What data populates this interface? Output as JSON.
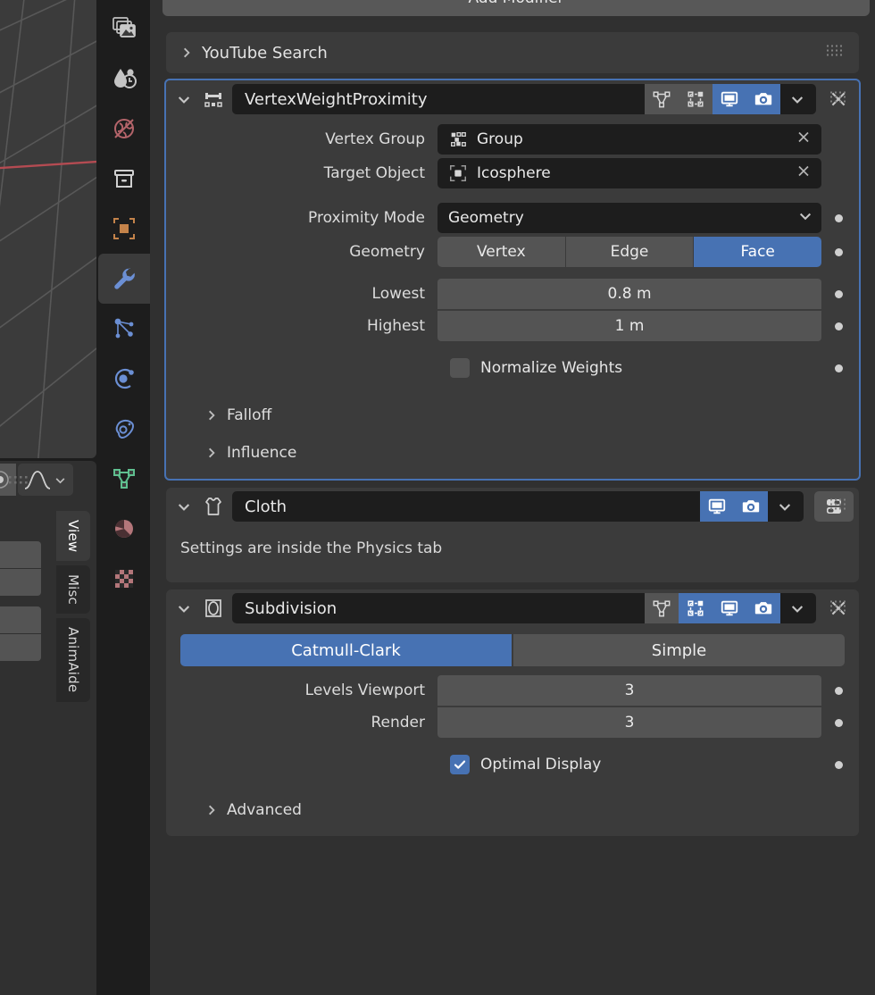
{
  "viewport": {
    "name": "3d-viewport",
    "grid_color": "#555555",
    "x_axis_color": "#b44b52",
    "background": "#3b3b3b"
  },
  "sidebar_tabs": [
    {
      "label": "View",
      "active": true
    },
    {
      "label": "Misc",
      "active": false
    },
    {
      "label": "AnimAide",
      "active": false
    }
  ],
  "properties_tabs": [
    {
      "name": "render-tab",
      "icon": "render-images-icon",
      "color": "#c8c8c8",
      "active": false
    },
    {
      "name": "output-tab",
      "icon": "output-printer-icon",
      "color": "#c8c8c8",
      "active": false
    },
    {
      "name": "view-layer-tab",
      "icon": "view-layer-globe-icon",
      "color": "#b4646a",
      "active": false
    },
    {
      "name": "scene-tab",
      "icon": "scene-box-icon",
      "color": "#d0d0d0",
      "active": false
    },
    {
      "name": "object-tab",
      "icon": "object-square-icon",
      "color": "#c4834a",
      "active": false
    },
    {
      "name": "modifier-tab",
      "icon": "wrench-icon",
      "color": "#6b8fd4",
      "active": true
    },
    {
      "name": "particles-tab",
      "icon": "particles-icon",
      "color": "#6b8fd4",
      "active": false
    },
    {
      "name": "physics-tab",
      "icon": "physics-orbit-icon",
      "color": "#6b8fd4",
      "active": false
    },
    {
      "name": "constraints-tab",
      "icon": "constraint-icon",
      "color": "#6b8fd4",
      "active": false
    },
    {
      "name": "object-data-tab",
      "icon": "mesh-data-icon",
      "color": "#5fbf8f",
      "active": false
    },
    {
      "name": "material-tab",
      "icon": "material-sphere-icon",
      "color": "#b4767a",
      "active": false
    },
    {
      "name": "texture-tab",
      "icon": "texture-checker-icon",
      "color": "#b4767a",
      "active": false
    }
  ],
  "top_cut_button": {
    "label": "Add Modifier"
  },
  "panels": {
    "youtube_search": {
      "label": "YouTube Search",
      "expanded": false
    }
  },
  "modifiers": [
    {
      "name": "VertexWeightProximity",
      "type_icon": "vertex-weight-proximity-icon",
      "active": true,
      "expanded": true,
      "header_toggles": [
        {
          "name": "edit-mode-toggle",
          "icon": "edit-mode-icon",
          "on": false
        },
        {
          "name": "on-cage-toggle",
          "icon": "on-cage-icon",
          "on": false
        },
        {
          "name": "realtime-toggle",
          "icon": "monitor-icon",
          "on": true
        },
        {
          "name": "render-toggle",
          "icon": "camera-icon",
          "on": true
        },
        {
          "name": "extras-dropdown",
          "icon": "chevron-down-icon",
          "on": false
        }
      ],
      "close_button": "close-x-icon",
      "fields": [
        {
          "kind": "id-field",
          "label": "Vertex Group",
          "value": "Group",
          "icon": "vertex-group-icon",
          "clearable": true,
          "decorator": false
        },
        {
          "kind": "id-field",
          "label": "Target Object",
          "value": "Icosphere",
          "icon": "object-data-icon",
          "clearable": true,
          "decorator": false
        },
        {
          "kind": "dropdown",
          "label": "Proximity Mode",
          "value": "Geometry",
          "decorator": true
        },
        {
          "kind": "segmented",
          "label": "Geometry",
          "options": [
            "Vertex",
            "Edge",
            "Face"
          ],
          "selected": "Face",
          "decorator": true
        },
        {
          "kind": "number",
          "label": "Lowest",
          "value": "0.8 m",
          "decorator": true,
          "group": "top"
        },
        {
          "kind": "number",
          "label": "Highest",
          "value": "1 m",
          "decorator": true,
          "group": "bottom"
        },
        {
          "kind": "checkbox",
          "label": "Normalize Weights",
          "checked": false,
          "decorator": true
        }
      ],
      "subpanels": [
        {
          "label": "Falloff",
          "expanded": false
        },
        {
          "label": "Influence",
          "expanded": false
        }
      ]
    },
    {
      "name": "Cloth",
      "type_icon": "cloth-shirt-icon",
      "active": false,
      "expanded": true,
      "header_toggles": [
        {
          "name": "realtime-toggle",
          "icon": "monitor-icon",
          "on": true
        },
        {
          "name": "render-toggle",
          "icon": "camera-icon",
          "on": true
        },
        {
          "name": "extras-dropdown",
          "icon": "chevron-down-icon",
          "on": false
        }
      ],
      "physics_button": "physics-panel-icon",
      "info_text": "Settings are inside the Physics tab",
      "fields": [],
      "subpanels": []
    },
    {
      "name": "Subdivision",
      "type_icon": "subdivision-icon",
      "active": false,
      "expanded": true,
      "header_toggles": [
        {
          "name": "edit-mode-toggle",
          "icon": "edit-mode-icon",
          "on": false
        },
        {
          "name": "on-cage-toggle",
          "icon": "on-cage-icon",
          "on": true
        },
        {
          "name": "realtime-toggle",
          "icon": "monitor-icon",
          "on": true
        },
        {
          "name": "render-toggle",
          "icon": "camera-icon",
          "on": true
        },
        {
          "name": "extras-dropdown",
          "icon": "chevron-down-icon",
          "on": false
        }
      ],
      "close_button": "close-x-icon",
      "subdivision_type": {
        "options": [
          "Catmull-Clark",
          "Simple"
        ],
        "selected": "Catmull-Clark"
      },
      "fields": [
        {
          "kind": "number",
          "label": "Levels Viewport",
          "value": "3",
          "decorator": true,
          "group": "top"
        },
        {
          "kind": "number",
          "label": "Render",
          "value": "3",
          "decorator": true,
          "group": "bottom"
        },
        {
          "kind": "checkbox",
          "label": "Optimal Display",
          "checked": true,
          "decorator": true
        }
      ],
      "subpanels": [
        {
          "label": "Advanced",
          "expanded": false
        }
      ]
    }
  ],
  "colors": {
    "accent_blue": "#4772b3",
    "panel_bg": "#3b3b3b",
    "editor_bg": "#303030",
    "field_dark": "#1d1d1d",
    "field_mid": "#545454",
    "text": "#e6e6e6"
  }
}
